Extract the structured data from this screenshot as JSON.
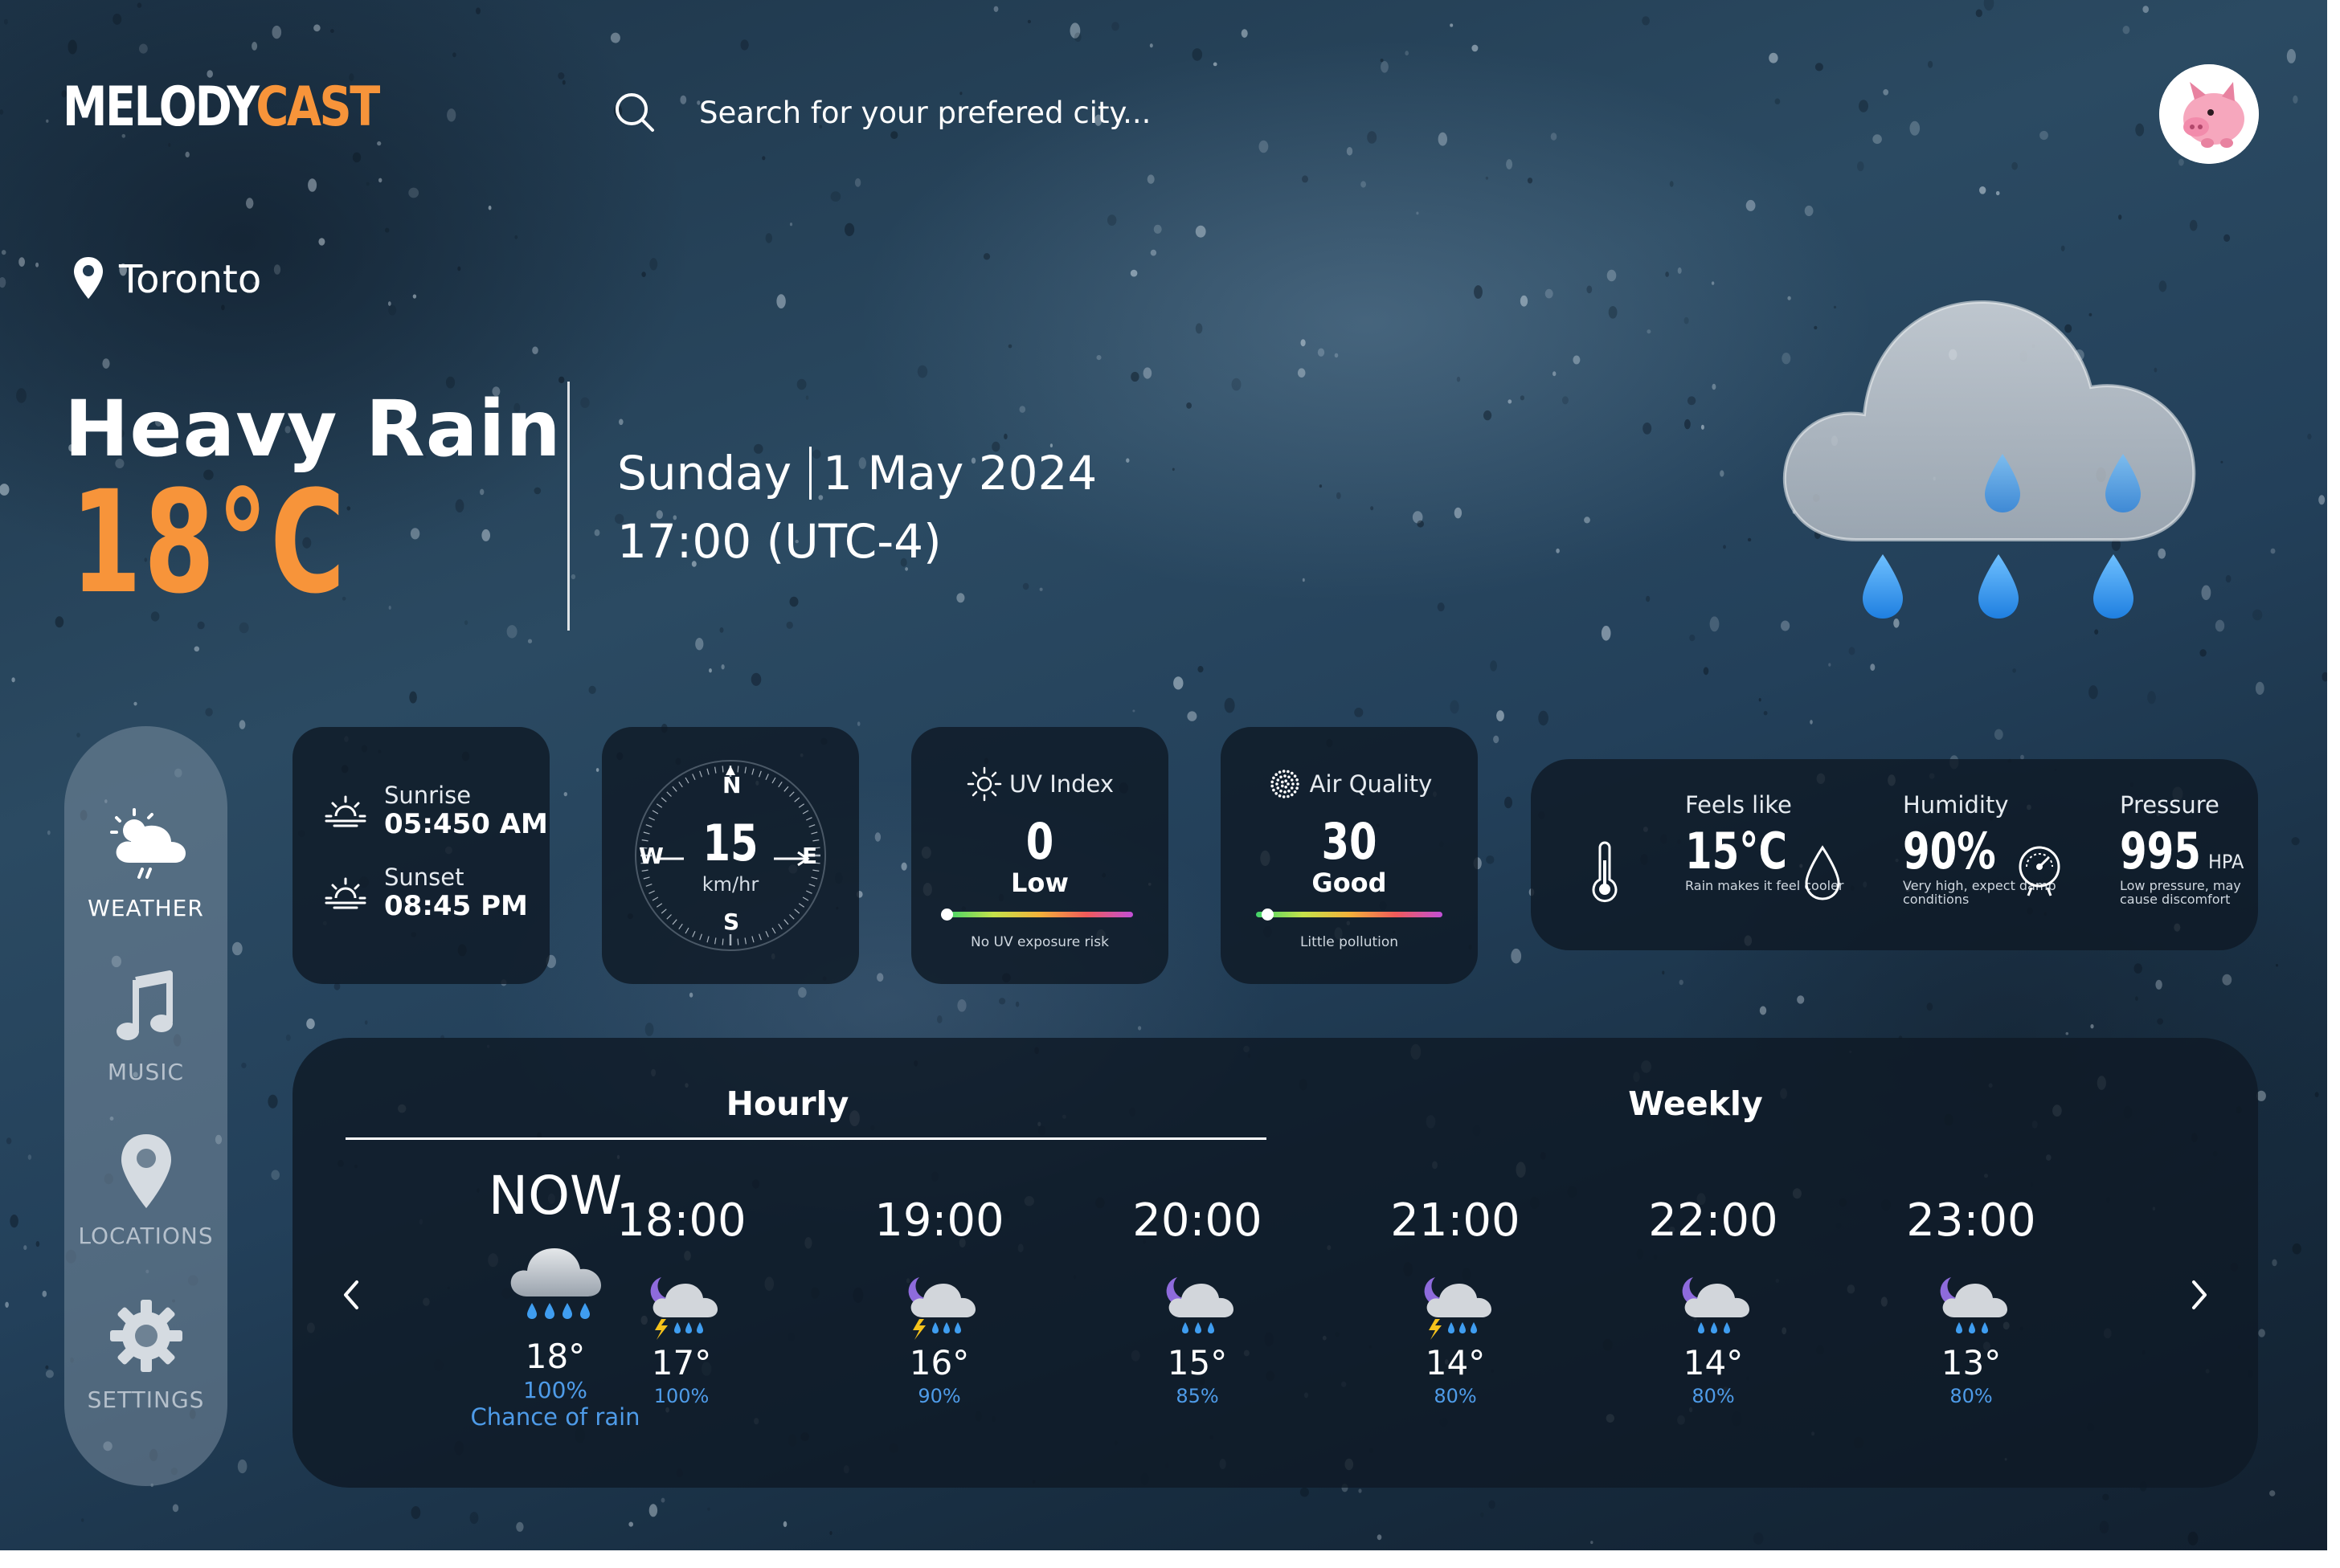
{
  "header": {
    "logo_part1": "MELODY",
    "logo_part2": "CAST",
    "search_placeholder": "Search for your prefered city..."
  },
  "location": "Toronto",
  "current": {
    "condition": "Heavy Rain",
    "temperature": "18°C",
    "day": "Sunday",
    "date": "1 May 2024",
    "time": "17:00 (UTC-4)"
  },
  "sidebar": {
    "items": [
      {
        "label": "WEATHER",
        "icon": "weather-icon",
        "active": true
      },
      {
        "label": "MUSIC",
        "icon": "music-icon",
        "active": false
      },
      {
        "label": "LOCATIONS",
        "icon": "location-pin-icon",
        "active": false
      },
      {
        "label": "SETTINGS",
        "icon": "gear-icon",
        "active": false
      }
    ]
  },
  "sun": {
    "sunrise_label": "Sunrise",
    "sunrise_time": "05:450 AM",
    "sunset_label": "Sunset",
    "sunset_time": "08:45 PM"
  },
  "wind": {
    "speed": "15",
    "unit": "km/hr",
    "north": "N",
    "south": "S",
    "west": "W",
    "east": "E"
  },
  "uv": {
    "title": "UV Index",
    "value": "0",
    "level": "Low",
    "note": "No UV exposure risk",
    "fraction": 0
  },
  "air": {
    "title": "Air Quality",
    "value": "30",
    "level": "Good",
    "note": "Little pollution",
    "fraction": 0.06
  },
  "stats": {
    "feels_label": "Feels like",
    "feels_value": "15°C",
    "feels_note": "Rain makes it feel cooler",
    "humidity_label": "Humidity",
    "humidity_value": "90%",
    "humidity_note": "Very high, expect damp conditions",
    "pressure_label": "Pressure",
    "pressure_value": "995",
    "pressure_unit": "HPA",
    "pressure_note": "Low pressure, may cause discomfort"
  },
  "forecast": {
    "tab_hourly": "Hourly",
    "tab_weekly": "Weekly",
    "now": {
      "time": "NOW",
      "temp": "18°",
      "pct": "100%",
      "note": "Chance of rain",
      "icon": "rain-cloud-icon"
    },
    "hours": [
      {
        "time": "18:00",
        "temp": "17°",
        "pct": "100%",
        "icon": "night-thunderstorm-icon"
      },
      {
        "time": "19:00",
        "temp": "16°",
        "pct": "90%",
        "icon": "night-thunderstorm-icon"
      },
      {
        "time": "20:00",
        "temp": "15°",
        "pct": "85%",
        "icon": "night-rain-icon"
      },
      {
        "time": "21:00",
        "temp": "14°",
        "pct": "80%",
        "icon": "night-thunderstorm-icon"
      },
      {
        "time": "22:00",
        "temp": "14°",
        "pct": "80%",
        "icon": "night-rain-icon"
      },
      {
        "time": "23:00",
        "temp": "13°",
        "pct": "80%",
        "icon": "night-rain-icon"
      }
    ]
  },
  "colors": {
    "accent_orange": "#f7943a",
    "rain_blue": "#4e9be8",
    "card_bg": "#0f1a26"
  }
}
